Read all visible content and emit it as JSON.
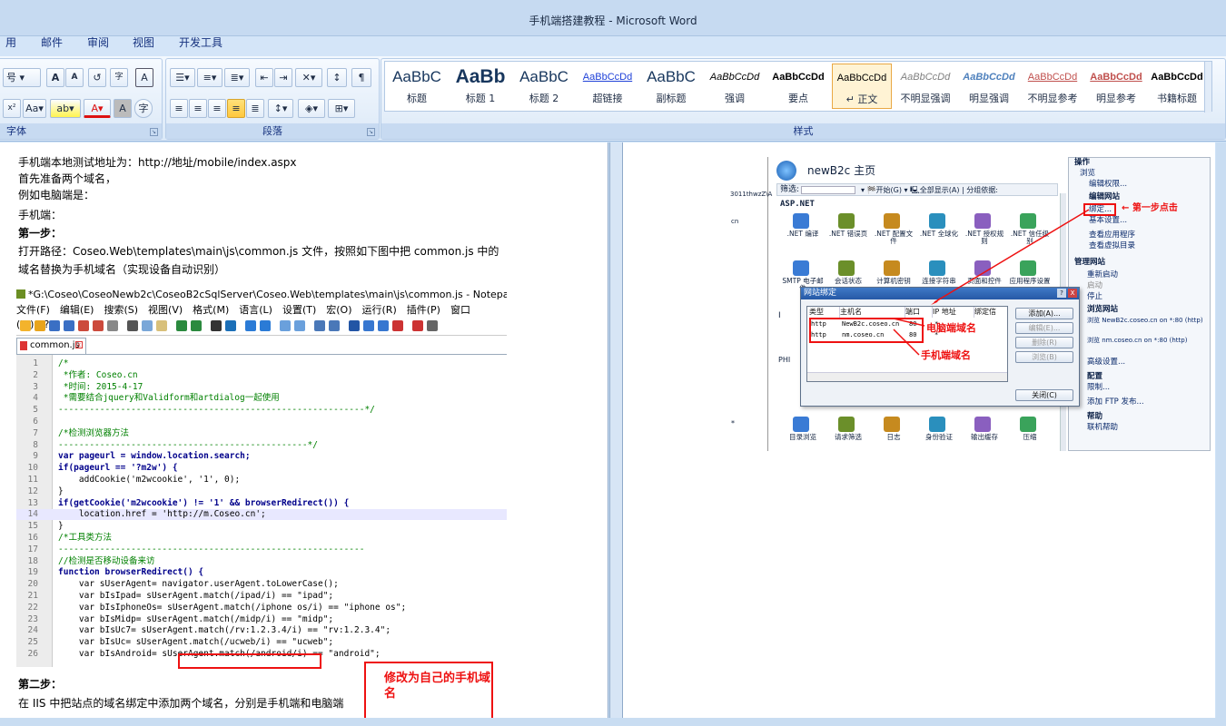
{
  "window": {
    "title": "手机端搭建教程 - Microsoft Word"
  },
  "ribbon_tabs": [
    "用",
    "邮件",
    "审阅",
    "视图",
    "开发工具"
  ],
  "font_group": {
    "title": "字体",
    "row1": [
      "号",
      "A",
      "A",
      "",
      "",
      "A"
    ],
    "row2": [
      "x²",
      "Aa",
      "ab",
      "A",
      "A",
      "字"
    ]
  },
  "paragraph_group": {
    "title": "段落"
  },
  "styles_group": {
    "title": "样式",
    "items": [
      {
        "sample": "AaBbC",
        "name": "标题",
        "selected": false
      },
      {
        "sample": "AaBb",
        "name": "标题 1",
        "selected": false
      },
      {
        "sample": "AaBbC",
        "name": "标题 2",
        "selected": false
      },
      {
        "sample": "AaBbCcDd",
        "name": "超链接",
        "selected": false
      },
      {
        "sample": "AaBbC",
        "name": "副标题",
        "selected": false
      },
      {
        "sample": "AaBbCcDd",
        "name": "强调",
        "selected": false
      },
      {
        "sample": "AaBbCcDd",
        "name": "要点",
        "selected": false
      },
      {
        "sample": "AaBbCcDd",
        "name": "↵ 正文",
        "selected": true
      },
      {
        "sample": "AaBbCcDd",
        "name": "不明显强调",
        "selected": false
      },
      {
        "sample": "AaBbCcDd",
        "name": "明显强调",
        "selected": false
      },
      {
        "sample": "AaBbCcDd",
        "name": "不明显参考",
        "selected": false
      },
      {
        "sample": "AaBbCcDd",
        "name": "明显参考",
        "selected": false
      },
      {
        "sample": "AaBbCcDd",
        "name": "书籍标题",
        "selected": false
      }
    ]
  },
  "document": {
    "lines": [
      "手机端本地测试地址为：http://地址/mobile/index.aspx",
      "首先准备两个域名，",
      "例如电脑端是：",
      "手机端：",
      "第一步：",
      "打开路径：Coseo.Web\\templates\\main\\js\\common.js 文件，按照如下图中把 common.js 中的",
      "域名替换为手机域名（实现设备自动识别）"
    ],
    "step2_title": "第二步：",
    "step2_text": "在 IIS 中把站点的域名绑定中添加两个域名，分别是手机端和电脑端"
  },
  "notepad": {
    "title": "*G:\\Coseo\\CoseoNewb2c\\CoseoB2cSqlServer\\Coseo.Web\\templates\\main\\js\\common.js - Notepad++",
    "menu": [
      "文件(F)",
      "编辑(E)",
      "搜索(S)",
      "视图(V)",
      "格式(M)",
      "语言(L)",
      "设置(T)",
      "宏(O)",
      "运行(R)",
      "插件(P)",
      "窗口(W)",
      "?"
    ],
    "tab": "common.js",
    "code": [
      {
        "n": "1",
        "t": "/*",
        "c": "cm"
      },
      {
        "n": "2",
        "t": " *作者: Coseo.cn",
        "c": "cm"
      },
      {
        "n": "3",
        "t": " *时间: 2015-4-17",
        "c": "cm"
      },
      {
        "n": "4",
        "t": " *需要结合jquery和Validform和artdialog一起使用",
        "c": "cm"
      },
      {
        "n": "5",
        "t": "-----------------------------------------------------------*/",
        "c": "cm"
      },
      {
        "n": "6",
        "t": "",
        "c": ""
      },
      {
        "n": "7",
        "t": "/*检测浏览器方法",
        "c": "cm"
      },
      {
        "n": "8",
        "t": "------------------------------------------------*/",
        "c": "cm"
      },
      {
        "n": "9",
        "t": "var pageurl = window.location.search;",
        "c": "kw"
      },
      {
        "n": "10",
        "t": "if(pageurl == '?m2w') {",
        "c": "kw"
      },
      {
        "n": "11",
        "t": "    addCookie('m2wcookie', '1', 0);",
        "c": ""
      },
      {
        "n": "12",
        "t": "}",
        "c": ""
      },
      {
        "n": "13",
        "t": "if(getCookie('m2wcookie') != '1' && browserRedirect()) {",
        "c": "kw"
      },
      {
        "n": "14",
        "t": "    location.href = 'http://m.Coseo.cn';",
        "c": "hi"
      },
      {
        "n": "15",
        "t": "}",
        "c": ""
      },
      {
        "n": "16",
        "t": "/*工具类方法",
        "c": "cm"
      },
      {
        "n": "17",
        "t": "-----------------------------------------------------------",
        "c": "cm"
      },
      {
        "n": "18",
        "t": "//检测是否移动设备来访",
        "c": "cm"
      },
      {
        "n": "19",
        "t": "function browserRedirect() {",
        "c": "kw"
      },
      {
        "n": "20",
        "t": "    var sUserAgent= navigator.userAgent.toLowerCase();",
        "c": ""
      },
      {
        "n": "21",
        "t": "    var bIsIpad= sUserAgent.match(/ipad/i) == \"ipad\";",
        "c": ""
      },
      {
        "n": "22",
        "t": "    var bIsIphoneOs= sUserAgent.match(/iphone os/i) == \"iphone os\";",
        "c": ""
      },
      {
        "n": "23",
        "t": "    var bIsMidp= sUserAgent.match(/midp/i) == \"midp\";",
        "c": ""
      },
      {
        "n": "24",
        "t": "    var bIsUc7= sUserAgent.match(/rv:1.2.3.4/i) == \"rv:1.2.3.4\";",
        "c": ""
      },
      {
        "n": "25",
        "t": "    var bIsUc= sUserAgent.match(/ucweb/i) == \"ucweb\";",
        "c": ""
      },
      {
        "n": "26",
        "t": "    var bIsAndroid= sUserAgent.match(/android/i) == \"android\";",
        "c": ""
      }
    ],
    "annotation": "修改为自己的手机域名"
  },
  "iis": {
    "title": "newB2c 主页",
    "filter_label": "筛选:",
    "filter_controls": "▾ 🏁开始(G) ▾ 🖳全部显示(A) | 分组依据:",
    "left_path": "3011thwzZ\\A",
    "left_cn": "cn",
    "left_star": "*",
    "section": "ASP.NET",
    "icons_row1": [
      ".NET 编译",
      ".NET 错误页",
      ".NET 配置文件",
      ".NET 全球化",
      ".NET 授权规则",
      ".NET 信任级别"
    ],
    "icons_row2": [
      "SMTP 电子邮件",
      "会话状态",
      "计算机密钥",
      "连接字符串",
      "页面和控件",
      "应用程序设置"
    ],
    "icons_row3": [
      "目录浏览",
      "请求筛选",
      "日志",
      "身份验证",
      "输出缓存",
      "压缩"
    ],
    "left_markers": [
      "I",
      "I",
      "PHI"
    ],
    "actions": {
      "header": "操作",
      "items": [
        "浏览",
        "编辑权限...",
        "编辑网站",
        "绑定...",
        "基本设置...",
        "查看应用程序",
        "查看虚拟目录",
        "管理网站",
        "重新启动",
        "启动",
        "停止",
        "浏览网站",
        "浏览 NewB2c.coseo.cn on *:80 (http)",
        "浏览 nm.coseo.cn on *:80 (http)",
        "高级设置...",
        "配置",
        "限制...",
        "添加 FTP 发布...",
        "帮助",
        "联机帮助"
      ]
    },
    "dialog": {
      "title": "网站绑定",
      "help": "?",
      "close_x": "X",
      "columns": [
        "类型",
        "主机名",
        "端口",
        "IP 地址",
        "绑定信"
      ],
      "rows": [
        {
          "type": "http",
          "host": "NewB2c.coseo.cn",
          "port": "80",
          "ip": "*"
        },
        {
          "type": "http",
          "host": "nm.coseo.cn",
          "port": "80",
          "ip": "*"
        }
      ],
      "buttons": [
        "添加(A)...",
        "编辑(E)...",
        "删除(R)",
        "浏览(B)"
      ],
      "close": "关闭(C)"
    },
    "annotations": {
      "step1": "第一步点击",
      "pc": "电脑端域名",
      "mobile": "手机端域名"
    }
  },
  "colors": {
    "accent": "#2b579a",
    "annotation_red": "#e11111"
  }
}
